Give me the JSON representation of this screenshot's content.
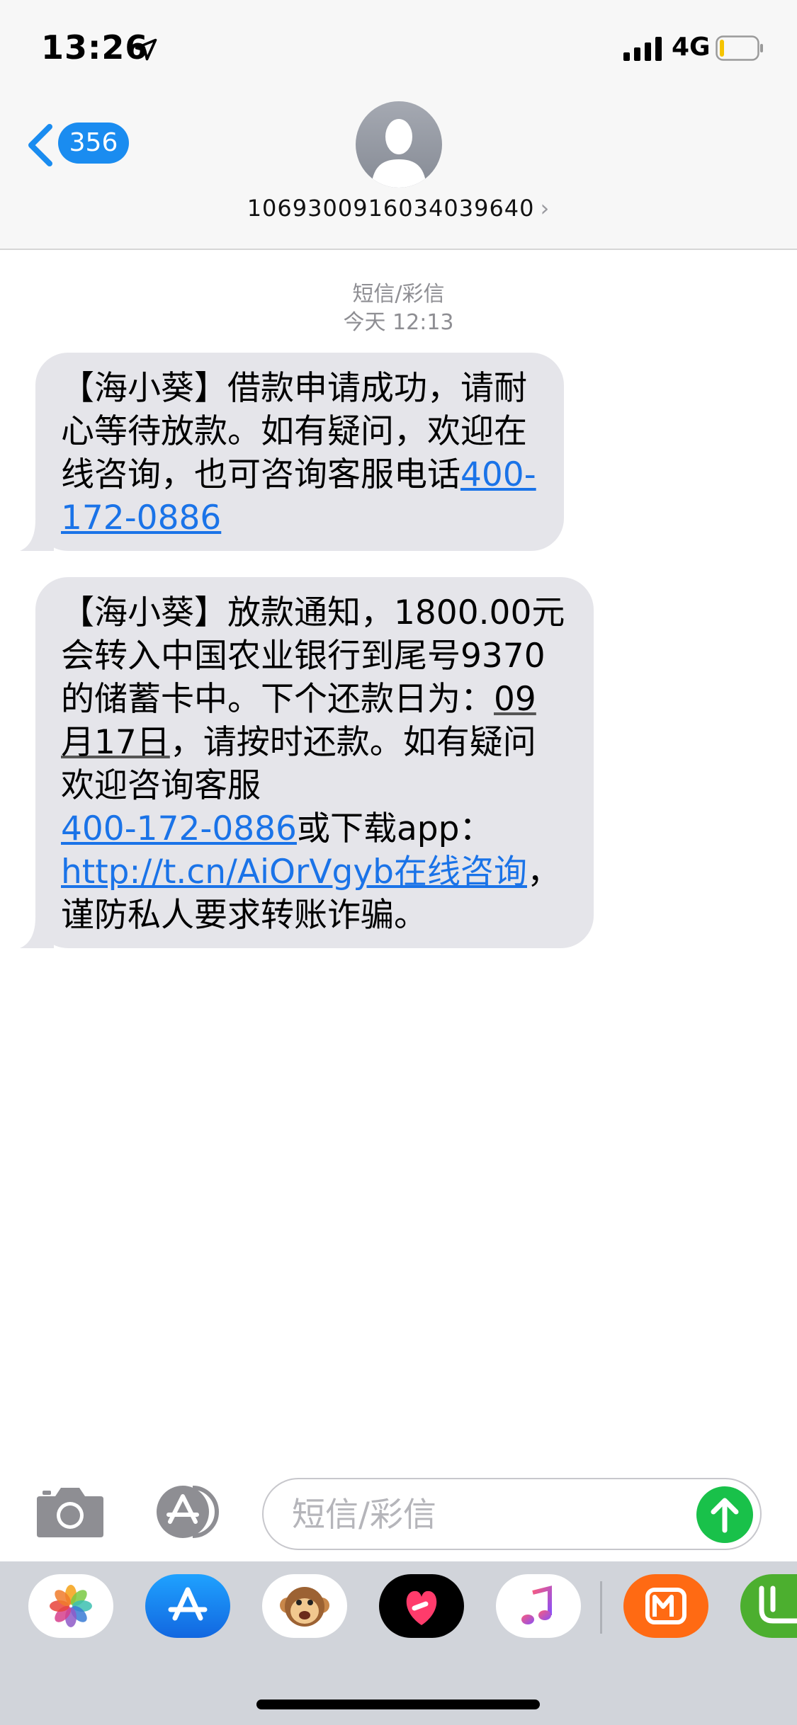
{
  "status_bar": {
    "time": "13:26",
    "network": "4G",
    "icons": [
      "location-arrow-icon",
      "signal-bars-icon",
      "battery-icon"
    ]
  },
  "header": {
    "back_count": "356",
    "contact_number": "1069300916034039640",
    "chevron": "›",
    "icons": [
      "back-chevron-icon",
      "contact-avatar-icon"
    ]
  },
  "conversation": {
    "message_type": "短信/彩信",
    "timestamp": "今天 12:13",
    "messages": [
      {
        "text_1": "【海小葵】借款申请成功，请耐心等待放款。如有疑问，欢迎在线咨询，也可咨询客服电话",
        "phone": "400-172-0886"
      },
      {
        "text_1": "【海小葵】放款通知，1800.00元会转入中国农业银行到尾号9370的储蓄卡中。下个还款日为：",
        "date": "09月17日",
        "text_2": "，请按时还款。如有疑问欢迎咨询客服",
        "phone": "400-172-0886",
        "text_3": "或下载app：",
        "link": "http://t.cn/AiOrVgyb在线咨询",
        "text_4": "，谨防私人要求转账诈骗。"
      }
    ]
  },
  "input_bar": {
    "placeholder": "短信/彩信",
    "value": "",
    "icons": [
      "camera-icon",
      "app-store-icon",
      "send-arrow-icon"
    ]
  },
  "app_drawer": {
    "apps": [
      "photos-app-icon",
      "app-store-app-icon",
      "animoji-monkey-icon",
      "digital-touch-heart-icon",
      "music-app-icon",
      "mango-tv-app-icon",
      "partial-app-icon"
    ],
    "colors": {
      "accent_blue": "#1a8cf0",
      "send_green": "#19c14a",
      "bubble_gray": "#e5e5ea",
      "link_blue": "#1a73e8"
    }
  }
}
